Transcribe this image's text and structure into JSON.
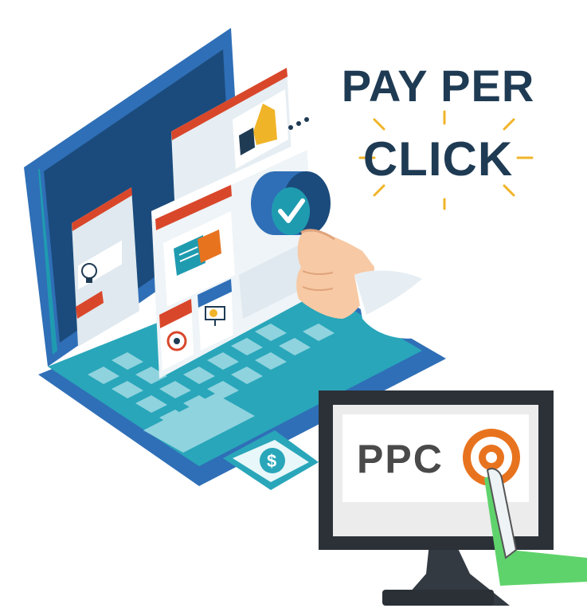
{
  "headline": {
    "line1": "PAY PER",
    "line2": "CLICK"
  },
  "monitor": {
    "label": "PPC"
  },
  "colors": {
    "navy": "#1f3b54",
    "teal": "#1f9bb0",
    "laptop_blue": "#2f6fb7",
    "screen_dark": "#1b4b7c",
    "orange": "#e8731f",
    "red": "#d9472b",
    "gold": "#f0b429",
    "green": "#5fd36b",
    "key_teal": "#8fd3de"
  },
  "icons": [
    "checkmark-icon",
    "chat-bubble-icon",
    "lightbulb-icon",
    "target-icon",
    "presentation-icon",
    "dollar-icon",
    "target-bullseye-icon",
    "thumbs-up-icon"
  ]
}
